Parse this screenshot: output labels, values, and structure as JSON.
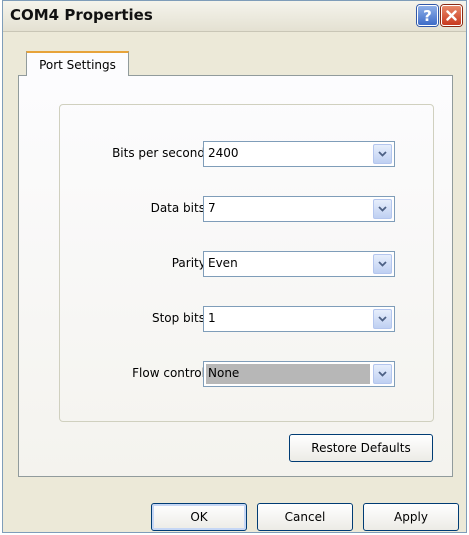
{
  "window": {
    "title": "COM4 Properties"
  },
  "tabs": [
    {
      "label": "Port Settings"
    }
  ],
  "fields": [
    {
      "label": "Bits per second:",
      "value": "2400"
    },
    {
      "label": "Data bits:",
      "value": "7"
    },
    {
      "label": "Parity:",
      "value": "Even"
    },
    {
      "label": "Stop bits:",
      "value": "1"
    },
    {
      "label": "Flow control:",
      "value": "None"
    }
  ],
  "buttons": {
    "restore": "Restore Defaults",
    "ok": "OK",
    "cancel": "Cancel",
    "apply": "Apply",
    "help": "?"
  },
  "icons": {
    "help": "question-mark-icon",
    "close": "close-x-icon",
    "dropdown": "chevron-down-icon"
  }
}
